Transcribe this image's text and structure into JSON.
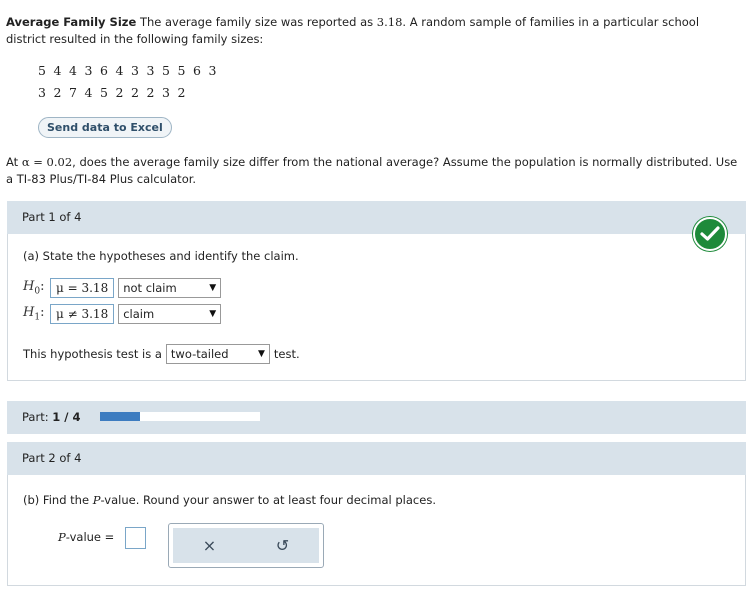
{
  "intro": {
    "title": "Average Family Size",
    "text_a": "The average family size was reported as",
    "reported_value": "3.18",
    "text_b": ". A random sample of families in a particular school district resulted in the following family sizes:"
  },
  "data": {
    "row1": [
      "5",
      "4",
      "4",
      "3",
      "6",
      "4",
      "3",
      "3",
      "5",
      "5",
      "6",
      "3"
    ],
    "row2": [
      "3",
      "2",
      "7",
      "4",
      "5",
      "2",
      "2",
      "2",
      "3",
      "2"
    ]
  },
  "excel_button": "Send data to Excel",
  "question": {
    "prefix": "At",
    "alpha": "α = 0.02",
    "rest": ", does the average family size differ from the national average? Assume the population is normally distributed. Use a TI-83 Plus/TI-84 Plus calculator."
  },
  "part1": {
    "header": "Part 1 of 4",
    "prompt": "(a) State the hypotheses and identify the claim.",
    "h0_label": "H",
    "h0_sub": "0",
    "h1_label": "H",
    "h1_sub": "1",
    "colon": ":",
    "h0_value": "μ = 3.18",
    "h0_select": "not claim",
    "h1_value": "μ ≠ 3.18",
    "h1_select": "claim",
    "test_prefix": "This hypothesis test is a",
    "test_select": "two-tailed",
    "test_suffix": "test."
  },
  "progress": {
    "label": "Part:",
    "current": "1 / 4",
    "fraction": 0.25
  },
  "part2": {
    "header": "Part 2 of 4",
    "prompt_a": "(b) Find the",
    "prompt_p": "P",
    "prompt_b": "-value. Round your answer to at least four decimal places.",
    "pvalue_p": "P",
    "pvalue_label": "-value =",
    "clear_icon": "×",
    "undo_icon": "↺"
  },
  "colors": {
    "check": "#1e8a3a",
    "header_bg": "#d8e2ea",
    "progress_fill": "#3d7cc0"
  }
}
